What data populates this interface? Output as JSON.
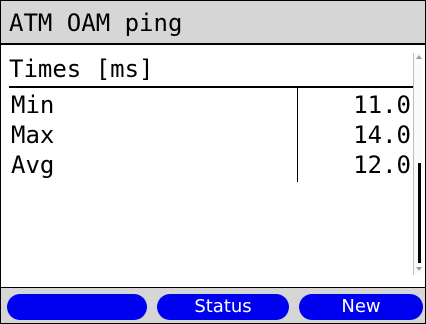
{
  "window": {
    "title": "ATM OAM ping"
  },
  "results": {
    "header": "Times [ms]",
    "rows": [
      {
        "label": "Min",
        "value": "11.0"
      },
      {
        "label": "Max",
        "value": "14.0"
      },
      {
        "label": "Avg",
        "value": "12.0"
      }
    ]
  },
  "softkeys": [
    {
      "label": ""
    },
    {
      "label": "Status"
    },
    {
      "label": "New"
    }
  ],
  "colors": {
    "softkey": "#0000f0",
    "bar_background": "#d6d6d6",
    "content_background": "#ffffff"
  }
}
